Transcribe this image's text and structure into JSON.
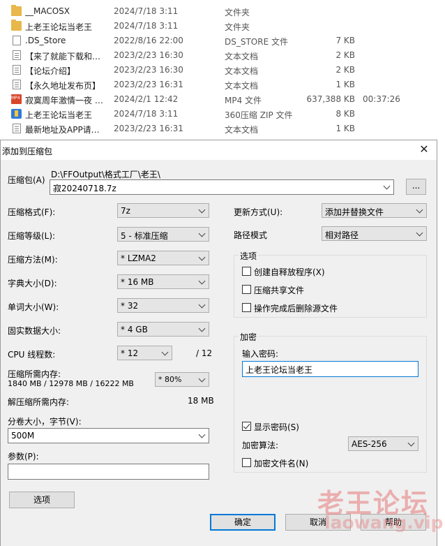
{
  "files": [
    {
      "icon": "folder-icon",
      "name": "__MACOSX",
      "date": "2024/7/18 3:11",
      "type": "文件夹",
      "size": "",
      "duration": ""
    },
    {
      "icon": "folder-icon",
      "name": "上老王论坛当老王",
      "date": "2024/7/18 3:11",
      "type": "文件夹",
      "size": "",
      "duration": ""
    },
    {
      "icon": "file-icon",
      "name": ".DS_Store",
      "date": "2022/8/16 22:00",
      "type": "DS_STORE 文件",
      "size": "7 KB",
      "duration": ""
    },
    {
      "icon": "text-document-icon",
      "name": "【来了就能下载和…",
      "date": "2023/2/23 16:30",
      "type": "文本文档",
      "size": "2 KB",
      "duration": ""
    },
    {
      "icon": "text-document-icon",
      "name": "【论坛介绍】",
      "date": "2023/2/23 16:30",
      "type": "文本文档",
      "size": "2 KB",
      "duration": ""
    },
    {
      "icon": "text-document-icon",
      "name": "【永久地址发布页】",
      "date": "2023/2/23 16:31",
      "type": "文本文档",
      "size": "1 KB",
      "duration": ""
    },
    {
      "icon": "mp4-icon",
      "name": "寂寞周年激情一夜 …",
      "date": "2024/2/1 12:42",
      "type": "MP4 文件",
      "size": "637,388 KB",
      "duration": "00:37:26"
    },
    {
      "icon": "zip-archive-icon",
      "name": "上老王论坛当老王",
      "date": "2024/7/18 3:11",
      "type": "360压缩 ZIP 文件",
      "size": "8 KB",
      "duration": ""
    },
    {
      "icon": "text-document-icon",
      "name": "最新地址及APP请…",
      "date": "2023/2/23 16:31",
      "type": "文本文档",
      "size": "1 KB",
      "duration": ""
    }
  ],
  "dialog": {
    "title": "添加到压缩包",
    "close_glyph": "✕",
    "archive": {
      "label": "压缩包(A)",
      "path": "D:\\FFOutput\\格式工厂\\老王\\",
      "filename": "寂20240718.7z",
      "browse_label": "..."
    },
    "left": {
      "format_label": "压缩格式(F):",
      "format_value": "7z",
      "level_label": "压缩等级(L):",
      "level_value": "5 - 标准压缩",
      "method_label": "压缩方法(M):",
      "method_value": "*  LZMA2",
      "dict_label": "字典大小(D):",
      "dict_value": "*  16 MB",
      "word_label": "单词大小(W):",
      "word_value": "*  32",
      "solid_label": "固实数据大小:",
      "solid_value": "*  4 GB",
      "cpu_label": "CPU 线程数:",
      "cpu_value": "*  12",
      "cpu_max": "/ 12",
      "mem_comp_label": "压缩所需内存:",
      "mem_comp_value": "1840 MB / 12978 MB / 16222 MB",
      "mem_percent": "* 80%",
      "mem_decomp_label": "解压缩所需内存:",
      "mem_decomp_value": "18 MB",
      "split_label": "分卷大小，字节(V):",
      "split_value": "500M",
      "params_label": "参数(P):",
      "params_value": "",
      "options_button": "选项"
    },
    "right": {
      "update_label": "更新方式(U):",
      "update_value": "添加并替换文件",
      "path_label": "路径模式",
      "path_value": "相对路径",
      "options_group": "选项",
      "opt_sfx": "创建自释放程序(X)",
      "opt_sfx_checked": false,
      "opt_shared": "压缩共享文件",
      "opt_shared_checked": false,
      "opt_delete": "操作完成后删除源文件",
      "opt_delete_checked": false,
      "encrypt_group": "加密",
      "password_label": "输入密码:",
      "password_value": "上老王论坛当老王",
      "show_password": "显示密码(S)",
      "show_password_checked": true,
      "enc_method_label": "加密算法:",
      "enc_method_value": "AES-256",
      "enc_names": "加密文件名(N)",
      "enc_names_checked": false
    },
    "buttons": {
      "ok": "确定",
      "cancel": "取消",
      "help": "帮助"
    }
  },
  "watermark": {
    "cn": "老王论坛",
    "en": "laowang.vip"
  }
}
